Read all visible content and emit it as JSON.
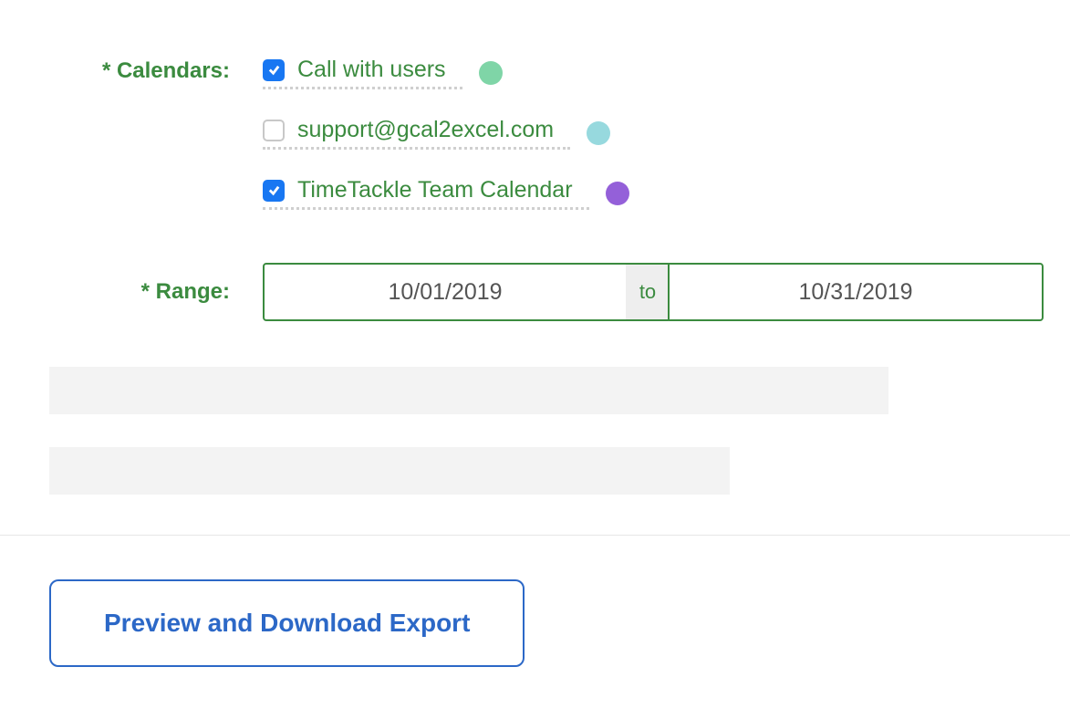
{
  "labels": {
    "calendars": "* Calendars:",
    "range": "* Range:"
  },
  "calendars": [
    {
      "name": "Call with users",
      "checked": true,
      "color": "#7fd5a7"
    },
    {
      "name": "support@gcal2excel.com",
      "checked": false,
      "color": "#97d9de"
    },
    {
      "name": "TimeTackle Team Calendar",
      "checked": true,
      "color": "#9460d9"
    }
  ],
  "range": {
    "start": "10/01/2019",
    "separator": "to",
    "end": "10/31/2019"
  },
  "actions": {
    "preview_download": "Preview and Download Export"
  }
}
